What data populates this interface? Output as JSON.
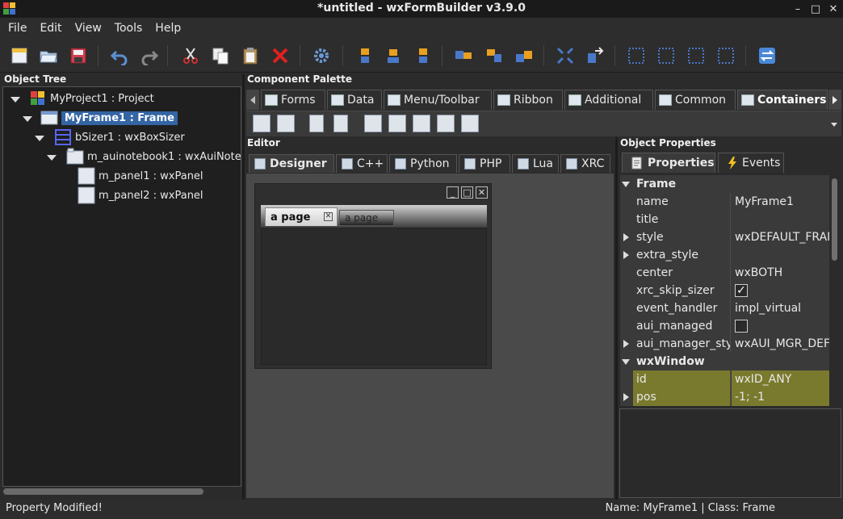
{
  "window": {
    "title": "*untitled - wxFormBuilder v3.9.0",
    "controls": [
      "minimize",
      "maximize",
      "close"
    ]
  },
  "menubar": [
    "File",
    "Edit",
    "View",
    "Tools",
    "Help"
  ],
  "toolbar": [
    "new-file-icon",
    "open-folder-icon",
    "save-icon",
    "undo-icon",
    "redo-icon",
    "cut-icon",
    "copy-icon",
    "paste-icon",
    "delete-icon",
    "generate-code-icon",
    "align-left-icon",
    "align-center-h-icon",
    "align-right-icon",
    "align-top-icon",
    "align-center-v-icon",
    "align-bottom-icon",
    "expand-icon",
    "stretch-icon",
    "border-left-icon",
    "border-right-icon",
    "border-top-icon",
    "border-bottom-icon",
    "swap-icon"
  ],
  "object_tree": {
    "title": "Object Tree",
    "items": [
      {
        "label": "MyProject1 : Project",
        "icon": "project-icon",
        "selected": false
      },
      {
        "label": "MyFrame1 : Frame",
        "icon": "frame-icon",
        "selected": true
      },
      {
        "label": "bSizer1 : wxBoxSizer",
        "icon": "boxsizer-icon",
        "selected": false
      },
      {
        "label": "m_auinotebook1 : wxAuiNote",
        "icon": "notebook-icon",
        "selected": false
      },
      {
        "label": "m_panel1 : wxPanel",
        "icon": "panel-icon",
        "selected": false
      },
      {
        "label": "m_panel2 : wxPanel",
        "icon": "panel-icon",
        "selected": false
      }
    ]
  },
  "palette": {
    "title": "Component Palette",
    "tabs": [
      "Forms",
      "Data",
      "Menu/Toolbar",
      "Ribbon",
      "Additional",
      "Common",
      "Containers"
    ],
    "active_tab": "Containers"
  },
  "editor": {
    "title": "Editor",
    "tabs": [
      "Designer",
      "C++",
      "Python",
      "PHP",
      "Lua",
      "XRC"
    ],
    "active_tab": "Designer",
    "frame_buttons": [
      "_",
      "□",
      "✕"
    ],
    "notebook_tabs": [
      "a page",
      "a page"
    ]
  },
  "properties": {
    "title": "Object Properties",
    "tabs": [
      "Properties",
      "Events"
    ],
    "active_tab": "Properties",
    "rows": [
      {
        "type": "category",
        "name": "Frame"
      },
      {
        "name": "name",
        "value": "MyFrame1"
      },
      {
        "name": "title",
        "value": ""
      },
      {
        "name": "style",
        "value": "wxDEFAULT_FRAM",
        "expandable": true
      },
      {
        "name": "extra_style",
        "value": "",
        "expandable": true
      },
      {
        "name": "center",
        "value": "wxBOTH"
      },
      {
        "name": "xrc_skip_sizer",
        "value": "",
        "checkbox": true,
        "checked": true
      },
      {
        "name": "event_handler",
        "value": "impl_virtual"
      },
      {
        "name": "aui_managed",
        "value": "",
        "checkbox": true,
        "checked": false
      },
      {
        "name": "aui_manager_styl",
        "value": "wxAUI_MGR_DEFA",
        "expandable": true
      },
      {
        "type": "category",
        "name": "wxWindow"
      },
      {
        "name": "id",
        "value": "wxID_ANY",
        "highlighted": true
      },
      {
        "name": "pos",
        "value": "-1; -1",
        "expandable": true,
        "highlighted": true
      }
    ]
  },
  "status": {
    "left": "Property Modified!",
    "right": "Name: MyFrame1 | Class: Frame"
  },
  "colors": {
    "selection": "#3465a4",
    "highlight_row": "#7a7a2e",
    "background": "#2b2b2b"
  }
}
